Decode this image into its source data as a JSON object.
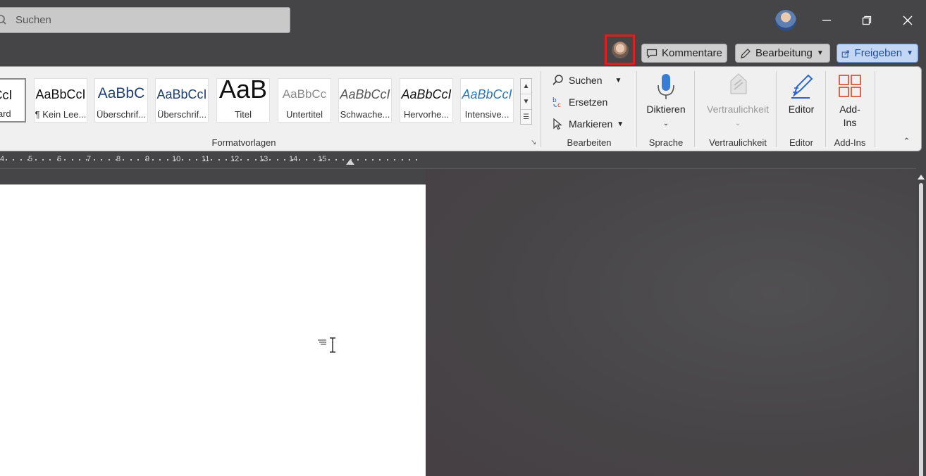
{
  "titlebar": {
    "search_placeholder": "Suchen"
  },
  "collab": {
    "comments_label": "Kommentare",
    "editing_label": "Bearbeitung",
    "share_label": "Freigeben"
  },
  "styles": [
    {
      "sample": "bCcI",
      "name": "ndard"
    },
    {
      "sample": "AaBbCcI",
      "name": "¶ Kein Lee..."
    },
    {
      "sample": "AaBbC",
      "name": "Überschrif..."
    },
    {
      "sample": "AaBbCcI",
      "name": "Überschrif..."
    },
    {
      "sample": "AaB",
      "name": "Titel"
    },
    {
      "sample": "AaBbCc",
      "name": "Untertitel"
    },
    {
      "sample": "AaBbCcI",
      "name": "Schwache..."
    },
    {
      "sample": "AaBbCcI",
      "name": "Hervorhe..."
    },
    {
      "sample": "AaBbCcI",
      "name": "Intensive..."
    }
  ],
  "ribbon": {
    "styles_group": "Formatvorlagen",
    "find": "Suchen",
    "replace": "Ersetzen",
    "select": "Markieren",
    "editing_group": "Bearbeiten",
    "dictate": "Diktieren",
    "voice_group": "Sprache",
    "sensitivity": "Vertraulichkeit",
    "sensitivity_group": "Vertraulichkeit",
    "editor": "Editor",
    "editor_group": "Editor",
    "addins_line1": "Add-",
    "addins_line2": "Ins",
    "addins_group": "Add-Ins"
  },
  "ruler_labels": [
    "4",
    "5",
    "6",
    "7",
    "8",
    "9",
    "10",
    "11",
    "12",
    "13",
    "14",
    "15"
  ],
  "colors": {
    "highlight": "#e01e1e",
    "share_button": "#c3d6f3",
    "background": "#454446"
  }
}
